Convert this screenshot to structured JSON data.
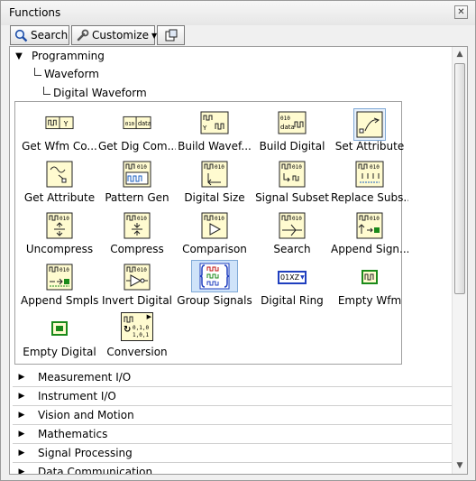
{
  "window": {
    "title": "Functions"
  },
  "toolbar": {
    "search_label": "Search",
    "customize_label": "Customize"
  },
  "tree": {
    "root": "Programming",
    "child": "Waveform",
    "grandchild": "Digital Waveform"
  },
  "palette": {
    "items": [
      {
        "label": "Get Wfm Co...",
        "icon": "get-waveform-components-icon"
      },
      {
        "label": "Get Dig Com...",
        "icon": "get-digital-components-icon"
      },
      {
        "label": "Build Wavef...",
        "icon": "build-waveform-icon"
      },
      {
        "label": "Build Digital",
        "icon": "build-digital-icon"
      },
      {
        "label": "Set Attribute",
        "icon": "set-attribute-icon"
      },
      {
        "label": "Get Attribute",
        "icon": "get-attribute-icon"
      },
      {
        "label": "Pattern Gen",
        "icon": "pattern-gen-icon"
      },
      {
        "label": "Digital Size",
        "icon": "digital-size-icon"
      },
      {
        "label": "Signal Subset",
        "icon": "signal-subset-icon"
      },
      {
        "label": "Replace Subs...",
        "icon": "replace-subset-icon"
      },
      {
        "label": "Uncompress",
        "icon": "uncompress-icon"
      },
      {
        "label": "Compress",
        "icon": "compress-icon"
      },
      {
        "label": "Comparison",
        "icon": "comparison-icon"
      },
      {
        "label": "Search",
        "icon": "search-digital-icon"
      },
      {
        "label": "Append Sign...",
        "icon": "append-signals-icon"
      },
      {
        "label": "Append Smpls",
        "icon": "append-samples-icon"
      },
      {
        "label": "Invert Digital",
        "icon": "invert-digital-icon"
      },
      {
        "label": "Group Signals",
        "icon": "group-signals-icon"
      },
      {
        "label": "Digital Ring",
        "icon": "digital-ring-icon"
      },
      {
        "label": "Empty Wfm",
        "icon": "empty-waveform-icon"
      },
      {
        "label": "Empty Digital",
        "icon": "empty-digital-icon"
      },
      {
        "label": "Conversion",
        "icon": "conversion-subpalette-icon"
      }
    ],
    "ring_text": "01XZ",
    "conversion_text_1": "0,1,0",
    "conversion_text_2": "1,0,1"
  },
  "categories": [
    "Measurement I/O",
    "Instrument I/O",
    "Vision and Motion",
    "Mathematics",
    "Signal Processing",
    "Data Communication"
  ],
  "colors": {
    "selection": "#cfe3f9",
    "icon_fill": "#fffbd0",
    "ring_blue": "#1f3fbf",
    "green": "#1a8a1a"
  }
}
